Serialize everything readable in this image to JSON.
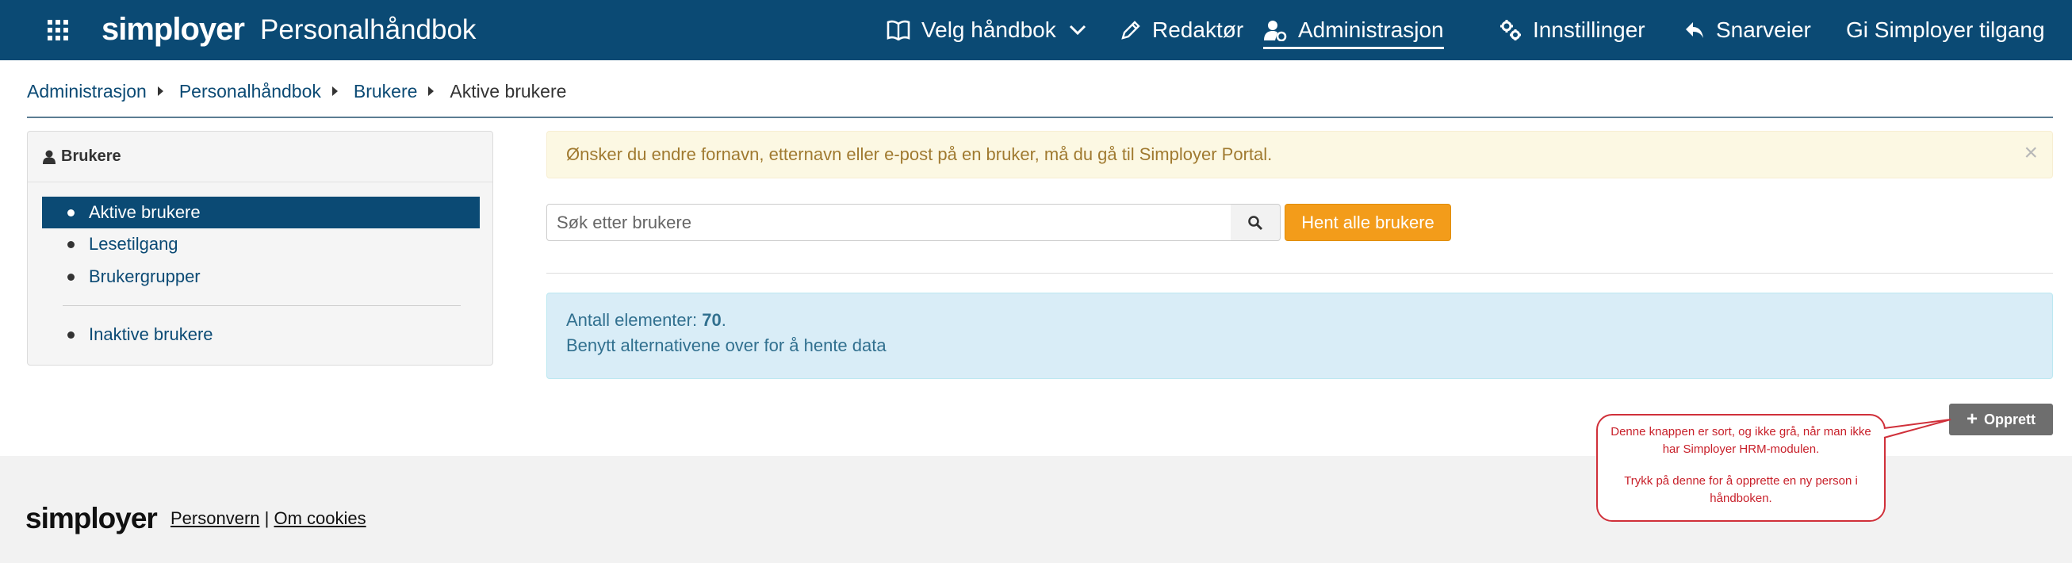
{
  "header": {
    "logo": "simployer",
    "app_title": "Personalhåndbok",
    "nav": {
      "choose_handbook": "Velg håndbok",
      "editor": "Redaktør",
      "administration": "Administrasjon",
      "settings": "Innstillinger",
      "shortcuts": "Snarveier",
      "grant_access": "Gi Simployer tilgang"
    }
  },
  "breadcrumb": {
    "items": [
      "Administrasjon",
      "Personalhåndbok",
      "Brukere"
    ],
    "current": "Aktive brukere"
  },
  "sidebar": {
    "title": "Brukere",
    "items": [
      {
        "label": "Aktive brukere",
        "active": true
      },
      {
        "label": "Lesetilgang",
        "active": false
      },
      {
        "label": "Brukergrupper",
        "active": false
      },
      {
        "label": "Inaktive brukere",
        "active": false
      }
    ]
  },
  "alert_warning": {
    "text": "Ønsker du endre fornavn, etternavn eller e-post på en bruker, må du gå til Simployer Portal.",
    "close_glyph": "×"
  },
  "search": {
    "placeholder": "Søk etter brukere",
    "fetch_all_label": "Hent alle brukere"
  },
  "info": {
    "count_label": "Antall elementer:",
    "count_value": "70",
    "count_suffix": ".",
    "hint": "Benytt alternativene over for å hente data"
  },
  "create_button": {
    "label": "Opprett"
  },
  "annotation": {
    "line1": "Denne knappen er sort, og ikke grå, når man ikke har Simployer HRM-modulen.",
    "line2": "Trykk på denne for å opprette en ny person i håndboken."
  },
  "footer": {
    "logo": "simployer",
    "privacy": "Personvern",
    "separator": " | ",
    "cookies": "Om cookies"
  },
  "colors": {
    "brand": "#0b4a74",
    "accent_orange": "#f39c1a",
    "annotation_red": "#d0303a"
  },
  "icons": [
    "apps-grid-icon",
    "book-icon",
    "chevron-down-icon",
    "pencil-icon",
    "user-cog-icon",
    "gears-icon",
    "reply-icon",
    "user-icon",
    "search-icon",
    "plus-icon",
    "close-icon"
  ]
}
